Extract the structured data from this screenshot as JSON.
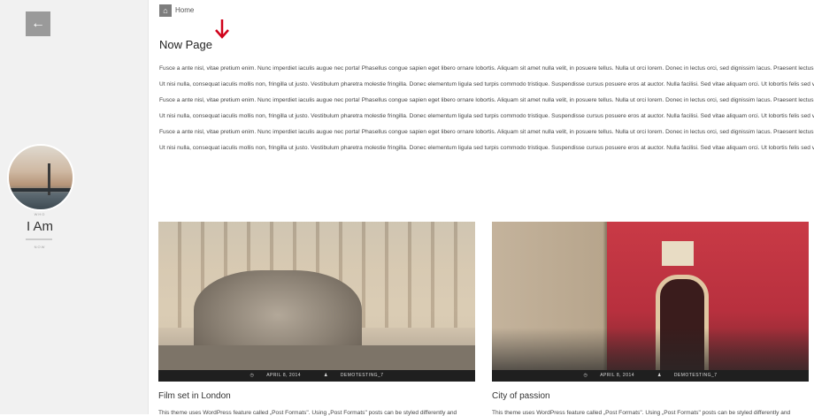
{
  "sidebar": {
    "back_icon": "←",
    "who_label": "WHO",
    "name": "I Am",
    "now_label": "NOW"
  },
  "breadcrumb": {
    "home_icon": "⌂",
    "label": "Home"
  },
  "page": {
    "title": "Now Page"
  },
  "content": {
    "paragraphs": [
      "Fusce a ante nisl, vitae pretium enim. Nunc imperdiet iaculis augue nec porta! Phasellus congue sapien eget libero ornare lobortis. Aliquam sit amet nulla velit, in posuere tellus. Nulla ut orci lorem. Donec in lectus orci, sed dignissim lacus. Praesent lectus diam, sodales at commodo sodales, hendrerit sit amet justo. Morbi a risus urna. Ut in lorem at nisl ultricies semper? Mauris imperdiet sem euismod ligula pulvinar hendrerit.",
      "Ut nisi nulla, consequat iaculis mollis non, fringilla ut justo. Vestibulum pharetra molestie fringilla. Donec elementum ligula sed turpis commodo tristique. Suspendisse cursus posuere eros at auctor. Nulla facilisi. Sed vitae aliquam orci. Ut lobortis felis sed viverra egestas, sem velit dapibus maur.",
      "Fusce a ante nisl, vitae pretium enim. Nunc imperdiet iaculis augue nec porta! Phasellus congue sapien eget libero ornare lobortis. Aliquam sit amet nulla velit, in posuere tellus. Nulla ut orci lorem. Donec in lectus orci, sed dignissim lacus. Praesent lectus diam, sodales at commodo sodales, hendrerit sit amet justo. Morbi a risus urna. Ut in lorem at nisl ultricies semper? Mauris imperdiet sem euismod ligula pulvinar hendrerit.",
      "Ut nisi nulla, consequat iaculis mollis non, fringilla ut justo. Vestibulum pharetra molestie fringilla. Donec elementum ligula sed turpis commodo tristique. Suspendisse cursus posuere eros at auctor. Nulla facilisi. Sed vitae aliquam orci. Ut lobortis felis sed viverra egestas, sem velit dapibus maur.",
      "Fusce a ante nisl, vitae pretium enim. Nunc imperdiet iaculis augue nec porta! Phasellus congue sapien eget libero ornare lobortis. Aliquam sit amet nulla velit, in posuere tellus. Nulla ut orci lorem. Donec in lectus orci, sed dignissim lacus. Praesent lectus diam, sodales at commodo sodales, hendrerit sit amet justo. Morbi a risus urna. Ut in lorem at nisl ultricies semper? Mauris imperdiet sem euismod ligula pulvinar hendrerit.",
      "Ut nisi nulla, consequat iaculis mollis non, fringilla ut justo. Vestibulum pharetra molestie fringilla. Donec elementum ligula sed turpis commodo tristique. Suspendisse cursus posuere eros at auctor. Nulla facilisi. Sed vitae aliquam orci. Ut lobortis felis sed viverra egestas, sem velit dapibus maur."
    ]
  },
  "posts": [
    {
      "date": "APRIL 8, 2014",
      "author": "DEMOTESTING_7",
      "title": "Film set in London",
      "excerpt": "This theme uses WordPress feature called „Post Formats\". Using „Post Formats\" posts can be styled differently and"
    },
    {
      "date": "APRIL 8, 2014",
      "author": "DEMOTESTING_7",
      "title": "City of passion",
      "excerpt": "This theme uses WordPress feature called „Post Formats\". Using „Post Formats\" posts can be styled differently and"
    }
  ],
  "icons": {
    "clock": "◷",
    "user": "♟"
  },
  "colors": {
    "sidebar_bg": "#f1f1f1",
    "meta_bar": "#1f1f1f",
    "arrow": "#d0021b"
  }
}
